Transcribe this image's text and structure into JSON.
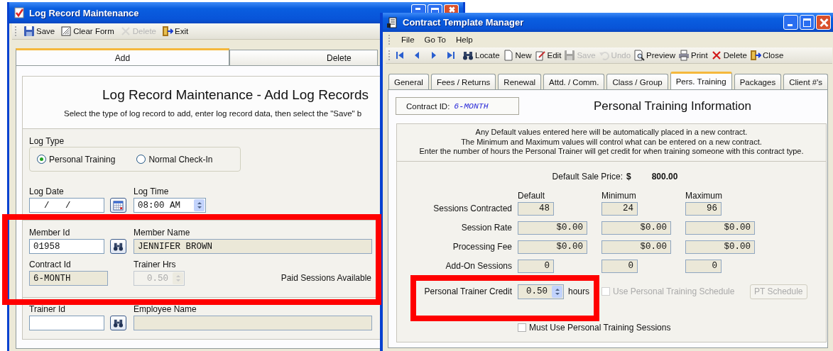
{
  "log_window": {
    "title": "Log Record Maintenance",
    "toolbar": [
      {
        "kind": "save",
        "label": "Save",
        "disabled": false
      },
      {
        "kind": "clear",
        "label": "Clear Form",
        "disabled": false
      },
      {
        "kind": "delete",
        "label": "Delete",
        "disabled": true
      },
      {
        "kind": "exit",
        "label": "Exit",
        "disabled": false
      }
    ],
    "tabs": [
      {
        "label": "Add",
        "selected": true
      },
      {
        "label": "Delete",
        "selected": false
      }
    ],
    "heading": "Log Record Maintenance - Add Log Records",
    "instructions": "Select the type of log record to add, enter log record data, then select the \"Save\" b",
    "log_type": {
      "label": "Log Type",
      "options": [
        {
          "label": "Personal Training",
          "selected": true
        },
        {
          "label": "Normal Check-In",
          "selected": false
        }
      ]
    },
    "log_date": {
      "label": "Log Date",
      "value": "  /   /"
    },
    "log_time": {
      "label": "Log Time",
      "value": "08:00 AM"
    },
    "member_id": {
      "label": "Member Id",
      "value": "01958"
    },
    "member_name": {
      "label": "Member Name",
      "value": "JENNIFER BROWN"
    },
    "contract_id": {
      "label": "Contract Id",
      "value": "6-MONTH"
    },
    "trainer_hrs": {
      "label": "Trainer Hrs",
      "value": "0.50",
      "disabled": true
    },
    "paid_sessions": "Paid Sessions Available",
    "trainer_id": {
      "label": "Trainer Id"
    },
    "employee_name": {
      "label": "Employee Name"
    }
  },
  "contract_window": {
    "title": "Contract Template Manager",
    "menu": [
      "File",
      "Go To",
      "Help"
    ],
    "toolbar": [
      {
        "kind": "first",
        "disabled": false
      },
      {
        "kind": "prev",
        "disabled": false
      },
      {
        "kind": "next",
        "disabled": false
      },
      {
        "kind": "last",
        "disabled": false
      },
      {
        "kind": "locate",
        "label": "Locate",
        "disabled": false
      },
      {
        "kind": "new",
        "label": "New",
        "disabled": false
      },
      {
        "kind": "edit",
        "label": "Edit",
        "disabled": false
      },
      {
        "kind": "save",
        "label": "Save",
        "disabled": true
      },
      {
        "kind": "undo",
        "label": "Undo",
        "disabled": true
      },
      {
        "kind": "preview",
        "label": "Preview",
        "disabled": false
      },
      {
        "kind": "print",
        "label": "Print",
        "disabled": false
      },
      {
        "kind": "delete",
        "label": "Delete",
        "disabled": false
      },
      {
        "kind": "exit",
        "label": "Close",
        "disabled": false
      }
    ],
    "tabs": [
      {
        "label": "General",
        "selected": false
      },
      {
        "label": "Fees / Returns",
        "selected": false
      },
      {
        "label": "Renewal",
        "selected": false
      },
      {
        "label": "Attd. / Comm.",
        "selected": false
      },
      {
        "label": "Class / Group",
        "selected": false
      },
      {
        "label": "Pers. Training",
        "selected": true
      },
      {
        "label": "Packages",
        "selected": false
      },
      {
        "label": "Client #'s",
        "selected": false
      }
    ],
    "contract_id": {
      "label": "Contract ID:",
      "value": "6-MONTH"
    },
    "heading": "Personal Training Information",
    "notes": [
      "Any Default values entered here will be automatically placed in a new contract.",
      "The Minimum and Maximum values will control what can be entered on a new contract.",
      "Enter the number of hours the Personal Trainer will get credit for when training someone with this contract type."
    ],
    "sale_price": {
      "label": "Default Sale Price:",
      "currency": "$",
      "value": "800.00"
    },
    "columns": [
      "Default",
      "Minimum",
      "Maximum"
    ],
    "rows": [
      {
        "label": "Sessions Contracted",
        "kind": "count",
        "values": [
          "48",
          "24",
          "96"
        ]
      },
      {
        "label": "Session Rate",
        "kind": "money",
        "values": [
          "$0.00",
          "$0.00",
          "$0.00"
        ]
      },
      {
        "label": "Processing Fee",
        "kind": "money",
        "values": [
          "$0.00",
          "$0.00",
          "$0.00"
        ]
      },
      {
        "label": "Add-On Sessions",
        "kind": "count",
        "values": [
          "0",
          "0",
          "0"
        ]
      }
    ],
    "credit": {
      "label": "Personal Trainer Credit",
      "value": "0.50",
      "unit": "hours"
    },
    "schedule_option": {
      "label": "Use Personal Training Schedule",
      "checked": false,
      "disabled": true
    },
    "schedule_button": {
      "label": "PT Schedule",
      "disabled": true
    },
    "must_use": {
      "label": "Must Use Personal Training Sessions",
      "checked": false
    }
  }
}
